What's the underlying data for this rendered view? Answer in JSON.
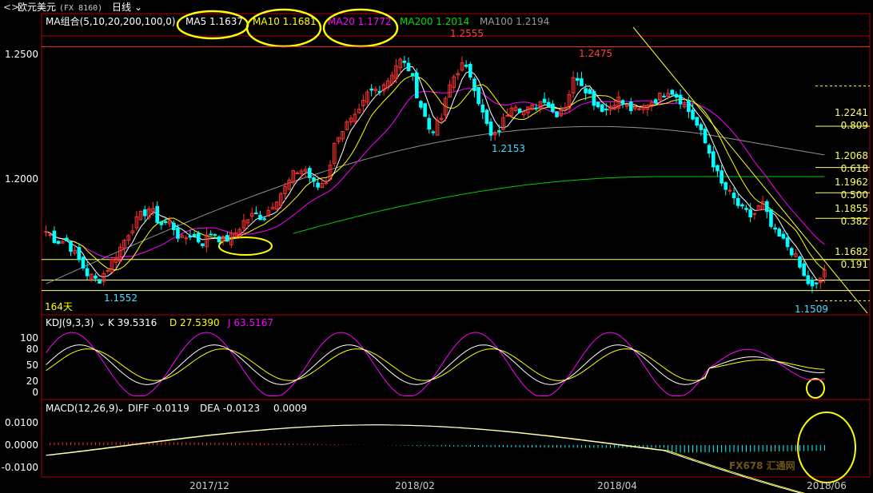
{
  "header": {
    "back_icon": "back-arrows-icon",
    "symbol": "欧元美元",
    "code": "(FX 8160)",
    "period": "日线",
    "dropdown_icon": "chevron-down-icon"
  },
  "price_panel": {
    "indicator": "MA组合(5,10,20,200,100,0)",
    "ma5": "MA5 1.1637",
    "ma10": "MA10 1.1681",
    "ma20": "MA20 1.1772",
    "ma200": "MA200 1.2014",
    "ma100": "MA100 1.2194",
    "days_label": "164天",
    "y_ticks": [
      "1.2500",
      "1.2000"
    ],
    "annotations": [
      {
        "text": "1.2555",
        "color": "#ff4040"
      },
      {
        "text": "1.2475",
        "color": "#ff4040"
      },
      {
        "text": "1.2153",
        "color": "#40e0ff"
      },
      {
        "text": "1.1552",
        "color": "#40e0ff"
      },
      {
        "text": "1.1509",
        "color": "#40e0ff"
      }
    ],
    "fib_levels": [
      {
        "price": "1.2241",
        "ratio": "0.809"
      },
      {
        "price": "1.2068",
        "ratio": "0.618"
      },
      {
        "price": "1.1962",
        "ratio": "0.500"
      },
      {
        "price": "1.1855",
        "ratio": "0.382"
      },
      {
        "price": "1.1682",
        "ratio": "0.191"
      }
    ]
  },
  "kdj_panel": {
    "indicator": "KDJ(9,3,3)",
    "k": "K 39.5316",
    "d": "D 27.5390",
    "j": "J 63.5167",
    "y_ticks": [
      "100",
      "80",
      "50",
      "20",
      "0"
    ]
  },
  "macd_panel": {
    "indicator": "MACD(12,26,9)",
    "diff": "DIFF -0.0119",
    "dea": "DEA -0.0123",
    "macd": "0.0009",
    "y_ticks": [
      "0.0100",
      "0.0000",
      "-0.0100"
    ]
  },
  "x_axis": {
    "labels": [
      "2017/12",
      "2018/02",
      "2018/04",
      "2018/06"
    ]
  },
  "watermark": "FX678 汇通网",
  "colors": {
    "up": "#ff3030",
    "down": "#00ffff",
    "ma5": "#ffffff",
    "ma10": "#ffff00",
    "ma20": "#ff00ff",
    "ma200": "#00cc00",
    "ma100": "#909090",
    "panel_border": "#b00000",
    "grid_text": "#ffffff",
    "highlight": "#ffff00"
  },
  "chart_data": {
    "type": "candlestick",
    "title": "欧元美元 (FX 8160) 日线",
    "x_range": [
      "2017/11",
      "2018/06"
    ],
    "y_range": [
      1.145,
      1.262
    ],
    "key_points": [
      {
        "label": "low",
        "value": 1.1552
      },
      {
        "label": "high",
        "value": 1.2555
      },
      {
        "label": "swing low",
        "value": 1.2153
      },
      {
        "label": "swing high",
        "value": 1.2475
      },
      {
        "label": "low",
        "value": 1.1509
      }
    ],
    "close_path": [
      1.18,
      1.176,
      1.176,
      1.169,
      1.162,
      1.159,
      1.165,
      1.172,
      1.18,
      1.186,
      1.19,
      1.183,
      1.184,
      1.176,
      1.179,
      1.175,
      1.18,
      1.176,
      1.178,
      1.184,
      1.187,
      1.186,
      1.193,
      1.198,
      1.205,
      1.206,
      1.198,
      1.202,
      1.22,
      1.225,
      1.228,
      1.238,
      1.24,
      1.244,
      1.252,
      1.248,
      1.234,
      1.222,
      1.226,
      1.243,
      1.25,
      1.245,
      1.23,
      1.218,
      1.226,
      1.235,
      1.23,
      1.232,
      1.236,
      1.229,
      1.233,
      1.246,
      1.24,
      1.233,
      1.231,
      1.236,
      1.232,
      1.23,
      1.234,
      1.236,
      1.24,
      1.236,
      1.23,
      1.222,
      1.212,
      1.2,
      1.195,
      1.189,
      1.186,
      1.192,
      1.18,
      1.176,
      1.171,
      1.161,
      1.155,
      1.164
    ],
    "series": [
      {
        "name": "MA5",
        "last": 1.1637
      },
      {
        "name": "MA10",
        "last": 1.1681
      },
      {
        "name": "MA20",
        "last": 1.1772
      },
      {
        "name": "MA200",
        "last": 1.2014
      },
      {
        "name": "MA100",
        "last": 1.2194
      }
    ],
    "fibonacci": [
      {
        "ratio": 0.809,
        "value": 1.2241
      },
      {
        "ratio": 0.618,
        "value": 1.2068
      },
      {
        "ratio": 0.5,
        "value": 1.1962
      },
      {
        "ratio": 0.382,
        "value": 1.1855
      },
      {
        "ratio": 0.191,
        "value": 1.1682
      }
    ],
    "kdj": {
      "k": 39.5316,
      "d": 27.539,
      "j": 63.5167,
      "y_ticks": [
        100,
        80,
        50,
        20,
        0
      ]
    },
    "macd": {
      "diff": -0.0119,
      "dea": -0.0123,
      "macd": 0.0009,
      "y_ticks": [
        0.01,
        0.0,
        -0.01
      ]
    }
  }
}
